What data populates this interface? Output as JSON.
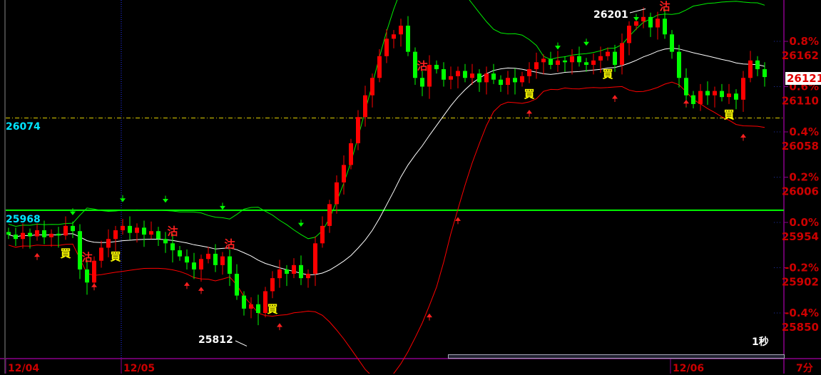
{
  "chart_data": {
    "type": "candlestick",
    "base_price": 25954,
    "y_ticks": [
      {
        "pct": "0.8%",
        "price": "26162"
      },
      {
        "pct": "0.6%",
        "price": "26110"
      },
      {
        "pct": "0.4%",
        "price": "26058"
      },
      {
        "pct": "0.2%",
        "price": "26006"
      },
      {
        "pct": "0.0%",
        "price": "25954"
      },
      {
        "pct": "-0.2%",
        "price": "25902"
      },
      {
        "pct": "-0.4%",
        "price": "25850"
      }
    ],
    "x_labels": [
      {
        "label": "12/04",
        "index": 0
      },
      {
        "label": "12/05",
        "index": 16
      },
      {
        "label": "12/06",
        "index": 93
      }
    ],
    "closes": [
      25940,
      25935,
      25942,
      25938,
      25945,
      25937,
      25941,
      25939,
      25950,
      25944,
      25900,
      25885,
      25910,
      25925,
      25935,
      25945,
      25950,
      25942,
      25948,
      25940,
      25944,
      25935,
      25930,
      25922,
      25915,
      25908,
      25900,
      25912,
      25918,
      25905,
      25915,
      25895,
      25870,
      25855,
      25860,
      25850,
      25875,
      25890,
      25900,
      25895,
      25905,
      25890,
      25895,
      25930,
      25950,
      25975,
      26000,
      26020,
      26045,
      26075,
      26100,
      26120,
      26145,
      26165,
      26170,
      26180,
      26150,
      26120,
      26110,
      26135,
      26130,
      26118,
      26122,
      26128,
      26120,
      26125,
      26115,
      26125,
      26118,
      26112,
      26120,
      26115,
      26122,
      26130,
      26138,
      26142,
      26135,
      26140,
      26138,
      26145,
      26138,
      26135,
      26140,
      26145,
      26150,
      26135,
      26160,
      26180,
      26185,
      26190,
      26178,
      26188,
      26170,
      26150,
      26120,
      26100,
      26090,
      26105,
      26100,
      26105,
      26098,
      26102,
      26095,
      26120,
      26140,
      26130,
      26121
    ],
    "buy_signals": [
      8,
      15,
      37,
      73,
      84,
      101
    ],
    "sell_signals": [
      11,
      23,
      31,
      58,
      92
    ],
    "up_arrows": [
      4,
      12,
      25,
      27,
      38,
      59,
      63,
      73,
      85,
      95,
      103
    ],
    "down_arrows": [
      9,
      16,
      22,
      30,
      41,
      60,
      65,
      77,
      81,
      88,
      100,
      104
    ],
    "buy_label": "買",
    "sell_label": "沽",
    "ref_lines": [
      {
        "price": 26074,
        "label": "26074",
        "style": "dashed",
        "color": "#e0d000"
      },
      {
        "price": 25968,
        "label": "25968",
        "style": "solid",
        "color": "#00ff00"
      }
    ],
    "high_annotation": {
      "label": "26201",
      "price": 26201
    },
    "low_annotation": {
      "label": "25812",
      "price": 25812
    },
    "last_price": "26121",
    "period_label": "1秒",
    "interval_label": "7分",
    "colors": {
      "up": "#ff0000",
      "down": "#00ff00",
      "axis": "#cc0000",
      "frame": "#8b008b",
      "ma": "#ffffff",
      "upper": "#00ee00",
      "lower": "#ff0000"
    }
  }
}
